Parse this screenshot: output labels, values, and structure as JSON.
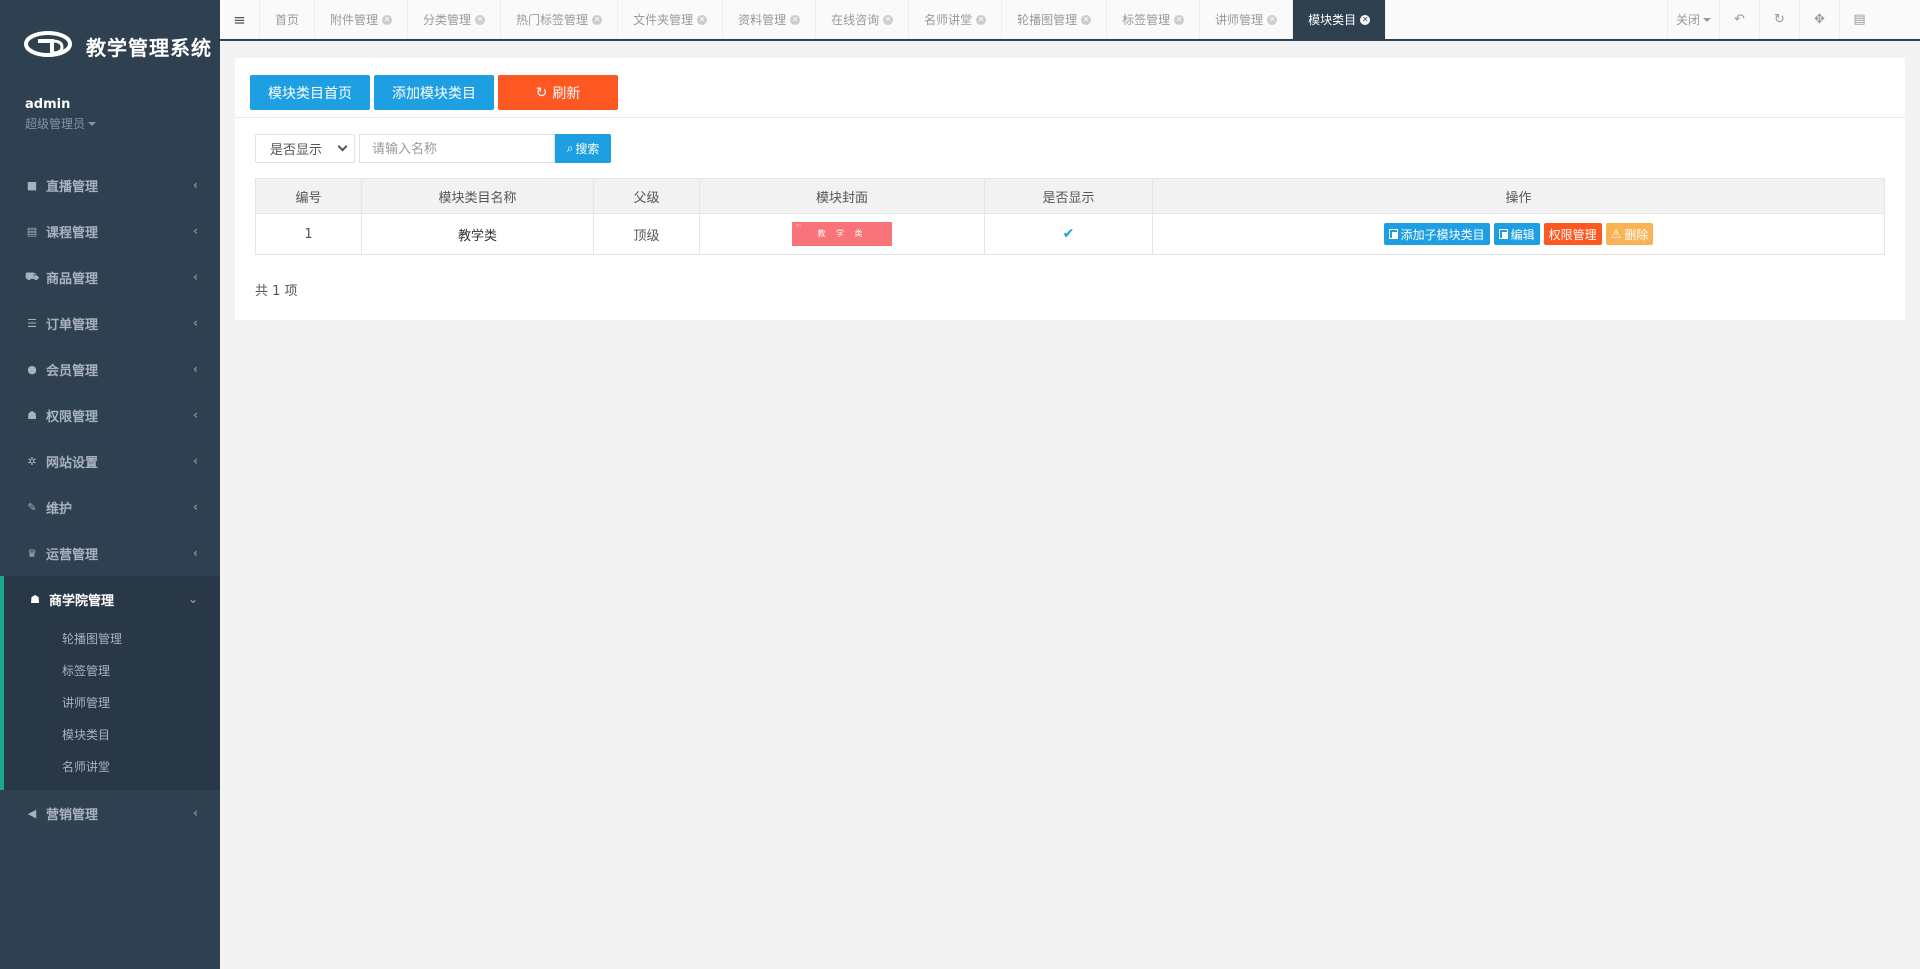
{
  "app": {
    "title": "教学管理系统"
  },
  "profile": {
    "username": "admin",
    "role": "超级管理员"
  },
  "sidebar": {
    "items": [
      {
        "label": "直播管理",
        "icon": "video-icon"
      },
      {
        "label": "课程管理",
        "icon": "book-icon"
      },
      {
        "label": "商品管理",
        "icon": "cart-icon"
      },
      {
        "label": "订单管理",
        "icon": "list-icon"
      },
      {
        "label": "会员管理",
        "icon": "user-icon"
      },
      {
        "label": "权限管理",
        "icon": "users-icon"
      },
      {
        "label": "网站设置",
        "icon": "gear-icon"
      },
      {
        "label": "维护",
        "icon": "wrench-icon"
      },
      {
        "label": "运营管理",
        "icon": "trophy-icon"
      }
    ],
    "active_group": {
      "label": "商学院管理",
      "icon": "users-icon",
      "children": [
        "轮播图管理",
        "标签管理",
        "讲师管理",
        "模块类目",
        "名师讲堂"
      ]
    },
    "bottom_item": {
      "label": "营销管理",
      "icon": "bullhorn-icon"
    }
  },
  "tabs": [
    {
      "label": "首页",
      "closable": false
    },
    {
      "label": "附件管理",
      "closable": true
    },
    {
      "label": "分类管理",
      "closable": true
    },
    {
      "label": "热门标签管理",
      "closable": true
    },
    {
      "label": "文件夹管理",
      "closable": true
    },
    {
      "label": "资料管理",
      "closable": true
    },
    {
      "label": "在线咨询",
      "closable": true
    },
    {
      "label": "名师讲堂",
      "closable": true
    },
    {
      "label": "轮播图管理",
      "closable": true
    },
    {
      "label": "标签管理",
      "closable": true
    },
    {
      "label": "讲师管理",
      "closable": true
    },
    {
      "label": "模块类目",
      "closable": true,
      "active": true
    }
  ],
  "tools": {
    "close_label": "关闭"
  },
  "toolbar": {
    "home_label": "模块类目首页",
    "add_label": "添加模块类目",
    "refresh_label": "刷新"
  },
  "filters": {
    "display_select": "是否显示",
    "search_placeholder": "请输入名称",
    "search_label": "搜索"
  },
  "table": {
    "headers": [
      "编号",
      "模块类目名称",
      "父级",
      "模块封面",
      "是否显示",
      "操作"
    ],
    "rows": [
      {
        "id": "1",
        "name": "教学类",
        "parent": "顶级",
        "cover_text": "教 学 类",
        "visible": true,
        "actions": {
          "add_child": "添加子模块类目",
          "edit": "编辑",
          "permission": "权限管理",
          "delete": "删除"
        }
      }
    ]
  },
  "footer": {
    "total": "共 1 项"
  },
  "colors": {
    "sidebar_bg": "#2f4050",
    "primary": "#1e9fe2",
    "danger": "#fd5722",
    "warning": "#fab354"
  }
}
